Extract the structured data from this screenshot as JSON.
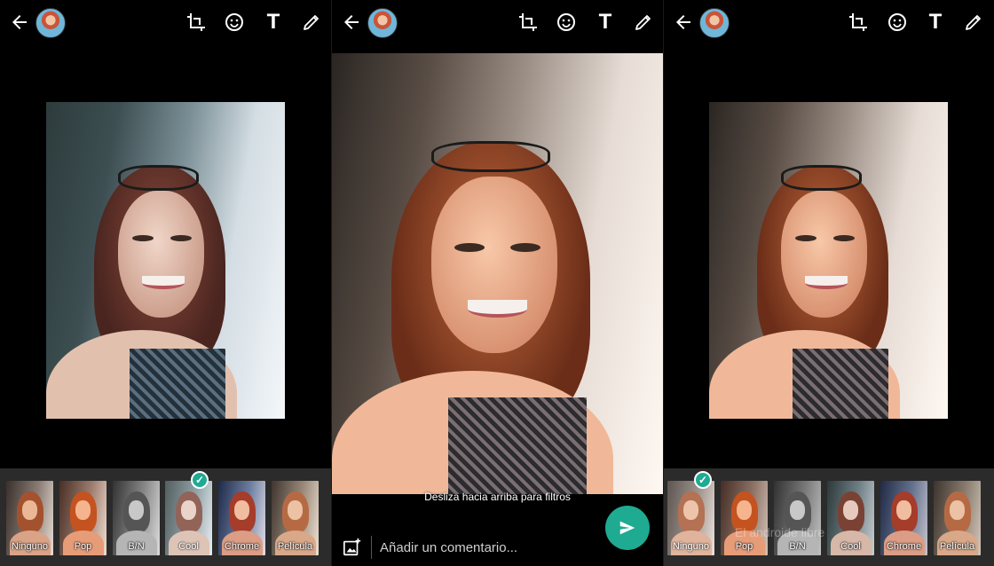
{
  "panels": [
    {
      "id": "left",
      "filter_labels": [
        "Ninguno",
        "Pop",
        "B/N",
        "Cool",
        "Chrome",
        "Película"
      ],
      "selected_filter": "Cool"
    },
    {
      "id": "middle",
      "hint": "Desliza hacia arriba para filtros",
      "comment_placeholder": "Añadir un comentario..."
    },
    {
      "id": "right",
      "filter_labels": [
        "Ninguno",
        "Pop",
        "B/N",
        "Cool",
        "Chrome",
        "Película"
      ],
      "selected_filter": "Ninguno",
      "watermark": "El androide libre"
    }
  ],
  "toolbar": {
    "text_tool_glyph": "T"
  },
  "colors": {
    "accent": "#1faa92",
    "filter_strip_bg": "#2b2b2b",
    "background": "#000000"
  },
  "icons": [
    "back-arrow-icon",
    "crop-rotate-icon",
    "emoji-icon",
    "text-icon",
    "pencil-icon",
    "add-media-icon",
    "send-icon",
    "check-icon"
  ]
}
